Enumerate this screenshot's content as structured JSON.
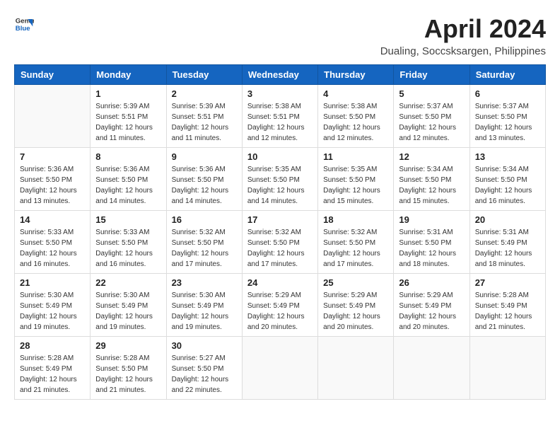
{
  "header": {
    "logo_general": "General",
    "logo_blue": "Blue",
    "title": "April 2024",
    "location": "Dualing, Soccsksargen, Philippines"
  },
  "weekdays": [
    "Sunday",
    "Monday",
    "Tuesday",
    "Wednesday",
    "Thursday",
    "Friday",
    "Saturday"
  ],
  "weeks": [
    [
      {
        "day": "",
        "sunrise": "",
        "sunset": "",
        "daylight": ""
      },
      {
        "day": "1",
        "sunrise": "Sunrise: 5:39 AM",
        "sunset": "Sunset: 5:51 PM",
        "daylight": "Daylight: 12 hours and 11 minutes."
      },
      {
        "day": "2",
        "sunrise": "Sunrise: 5:39 AM",
        "sunset": "Sunset: 5:51 PM",
        "daylight": "Daylight: 12 hours and 11 minutes."
      },
      {
        "day": "3",
        "sunrise": "Sunrise: 5:38 AM",
        "sunset": "Sunset: 5:51 PM",
        "daylight": "Daylight: 12 hours and 12 minutes."
      },
      {
        "day": "4",
        "sunrise": "Sunrise: 5:38 AM",
        "sunset": "Sunset: 5:50 PM",
        "daylight": "Daylight: 12 hours and 12 minutes."
      },
      {
        "day": "5",
        "sunrise": "Sunrise: 5:37 AM",
        "sunset": "Sunset: 5:50 PM",
        "daylight": "Daylight: 12 hours and 12 minutes."
      },
      {
        "day": "6",
        "sunrise": "Sunrise: 5:37 AM",
        "sunset": "Sunset: 5:50 PM",
        "daylight": "Daylight: 12 hours and 13 minutes."
      }
    ],
    [
      {
        "day": "7",
        "sunrise": "Sunrise: 5:36 AM",
        "sunset": "Sunset: 5:50 PM",
        "daylight": "Daylight: 12 hours and 13 minutes."
      },
      {
        "day": "8",
        "sunrise": "Sunrise: 5:36 AM",
        "sunset": "Sunset: 5:50 PM",
        "daylight": "Daylight: 12 hours and 14 minutes."
      },
      {
        "day": "9",
        "sunrise": "Sunrise: 5:36 AM",
        "sunset": "Sunset: 5:50 PM",
        "daylight": "Daylight: 12 hours and 14 minutes."
      },
      {
        "day": "10",
        "sunrise": "Sunrise: 5:35 AM",
        "sunset": "Sunset: 5:50 PM",
        "daylight": "Daylight: 12 hours and 14 minutes."
      },
      {
        "day": "11",
        "sunrise": "Sunrise: 5:35 AM",
        "sunset": "Sunset: 5:50 PM",
        "daylight": "Daylight: 12 hours and 15 minutes."
      },
      {
        "day": "12",
        "sunrise": "Sunrise: 5:34 AM",
        "sunset": "Sunset: 5:50 PM",
        "daylight": "Daylight: 12 hours and 15 minutes."
      },
      {
        "day": "13",
        "sunrise": "Sunrise: 5:34 AM",
        "sunset": "Sunset: 5:50 PM",
        "daylight": "Daylight: 12 hours and 16 minutes."
      }
    ],
    [
      {
        "day": "14",
        "sunrise": "Sunrise: 5:33 AM",
        "sunset": "Sunset: 5:50 PM",
        "daylight": "Daylight: 12 hours and 16 minutes."
      },
      {
        "day": "15",
        "sunrise": "Sunrise: 5:33 AM",
        "sunset": "Sunset: 5:50 PM",
        "daylight": "Daylight: 12 hours and 16 minutes."
      },
      {
        "day": "16",
        "sunrise": "Sunrise: 5:32 AM",
        "sunset": "Sunset: 5:50 PM",
        "daylight": "Daylight: 12 hours and 17 minutes."
      },
      {
        "day": "17",
        "sunrise": "Sunrise: 5:32 AM",
        "sunset": "Sunset: 5:50 PM",
        "daylight": "Daylight: 12 hours and 17 minutes."
      },
      {
        "day": "18",
        "sunrise": "Sunrise: 5:32 AM",
        "sunset": "Sunset: 5:50 PM",
        "daylight": "Daylight: 12 hours and 17 minutes."
      },
      {
        "day": "19",
        "sunrise": "Sunrise: 5:31 AM",
        "sunset": "Sunset: 5:50 PM",
        "daylight": "Daylight: 12 hours and 18 minutes."
      },
      {
        "day": "20",
        "sunrise": "Sunrise: 5:31 AM",
        "sunset": "Sunset: 5:49 PM",
        "daylight": "Daylight: 12 hours and 18 minutes."
      }
    ],
    [
      {
        "day": "21",
        "sunrise": "Sunrise: 5:30 AM",
        "sunset": "Sunset: 5:49 PM",
        "daylight": "Daylight: 12 hours and 19 minutes."
      },
      {
        "day": "22",
        "sunrise": "Sunrise: 5:30 AM",
        "sunset": "Sunset: 5:49 PM",
        "daylight": "Daylight: 12 hours and 19 minutes."
      },
      {
        "day": "23",
        "sunrise": "Sunrise: 5:30 AM",
        "sunset": "Sunset: 5:49 PM",
        "daylight": "Daylight: 12 hours and 19 minutes."
      },
      {
        "day": "24",
        "sunrise": "Sunrise: 5:29 AM",
        "sunset": "Sunset: 5:49 PM",
        "daylight": "Daylight: 12 hours and 20 minutes."
      },
      {
        "day": "25",
        "sunrise": "Sunrise: 5:29 AM",
        "sunset": "Sunset: 5:49 PM",
        "daylight": "Daylight: 12 hours and 20 minutes."
      },
      {
        "day": "26",
        "sunrise": "Sunrise: 5:29 AM",
        "sunset": "Sunset: 5:49 PM",
        "daylight": "Daylight: 12 hours and 20 minutes."
      },
      {
        "day": "27",
        "sunrise": "Sunrise: 5:28 AM",
        "sunset": "Sunset: 5:49 PM",
        "daylight": "Daylight: 12 hours and 21 minutes."
      }
    ],
    [
      {
        "day": "28",
        "sunrise": "Sunrise: 5:28 AM",
        "sunset": "Sunset: 5:49 PM",
        "daylight": "Daylight: 12 hours and 21 minutes."
      },
      {
        "day": "29",
        "sunrise": "Sunrise: 5:28 AM",
        "sunset": "Sunset: 5:50 PM",
        "daylight": "Daylight: 12 hours and 21 minutes."
      },
      {
        "day": "30",
        "sunrise": "Sunrise: 5:27 AM",
        "sunset": "Sunset: 5:50 PM",
        "daylight": "Daylight: 12 hours and 22 minutes."
      },
      {
        "day": "",
        "sunrise": "",
        "sunset": "",
        "daylight": ""
      },
      {
        "day": "",
        "sunrise": "",
        "sunset": "",
        "daylight": ""
      },
      {
        "day": "",
        "sunrise": "",
        "sunset": "",
        "daylight": ""
      },
      {
        "day": "",
        "sunrise": "",
        "sunset": "",
        "daylight": ""
      }
    ]
  ]
}
